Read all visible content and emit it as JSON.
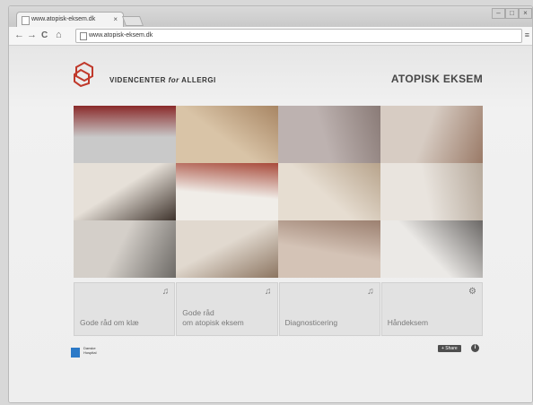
{
  "browser": {
    "tab_label": "www.atopisk-eksem.dk",
    "tab_close": "×",
    "url": "www.atopisk-eksem.dk",
    "nav_back": "←",
    "nav_forward": "→",
    "nav_reload": "C",
    "nav_home": "⌂",
    "menu": "≡",
    "win_min": "–",
    "win_max": "□",
    "win_close": "×"
  },
  "header": {
    "org_part1": "VIDENCENTER ",
    "org_for": "for",
    "org_part2": " ALLERGI",
    "site_title": "ATOPISK EKSEM"
  },
  "grid_tiles": [
    {
      "name": "tile-figures",
      "c1": "#c9c9c9",
      "c2": "#8a2a2a"
    },
    {
      "name": "tile-family-photo",
      "c1": "#d9c4a7",
      "c2": "#a88664"
    },
    {
      "name": "tile-silhouette",
      "c1": "#bdb2b0",
      "c2": "#8a7b77"
    },
    {
      "name": "tile-hazelnuts",
      "c1": "#d7ccc3",
      "c2": "#9a7a67"
    },
    {
      "name": "tile-parent-child",
      "c1": "#e6e0d8",
      "c2": "#3e332c"
    },
    {
      "name": "tile-cream-tubes",
      "c1": "#f0ede8",
      "c2": "#a84a3a"
    },
    {
      "name": "tile-hands-cream",
      "c1": "#e6ddd1",
      "c2": "#b8a48c"
    },
    {
      "name": "tile-plate-food",
      "c1": "#e9e4de",
      "c2": "#b7aa9c"
    },
    {
      "name": "tile-doctor",
      "c1": "#d4cfc9",
      "c2": "#6d6a66"
    },
    {
      "name": "tile-inhaler-girl",
      "c1": "#e1d9cf",
      "c2": "#8c7561"
    },
    {
      "name": "tile-hand-closeup",
      "c1": "#d4c3b6",
      "c2": "#9c8070"
    },
    {
      "name": "tile-open-book",
      "c1": "#ebe9e6",
      "c2": "#6b6866"
    }
  ],
  "boxes": [
    {
      "label": "Gode råd om klæ",
      "icon": "♫"
    },
    {
      "label_lines": [
        "Gode råd",
        "om atopisk eksem"
      ],
      "icon": "♫"
    },
    {
      "label": "Diagnosticering",
      "icon": "♫"
    },
    {
      "label": "Håndeksem",
      "icon": "⚙"
    }
  ],
  "footer": {
    "hospital_line1": "Danske",
    "hospital_line2": "Hospital",
    "share_label": "+ Share",
    "info_label": "i"
  },
  "colors": {
    "logo_red": "#c0392b",
    "hospital_blue": "#2b79c7"
  }
}
